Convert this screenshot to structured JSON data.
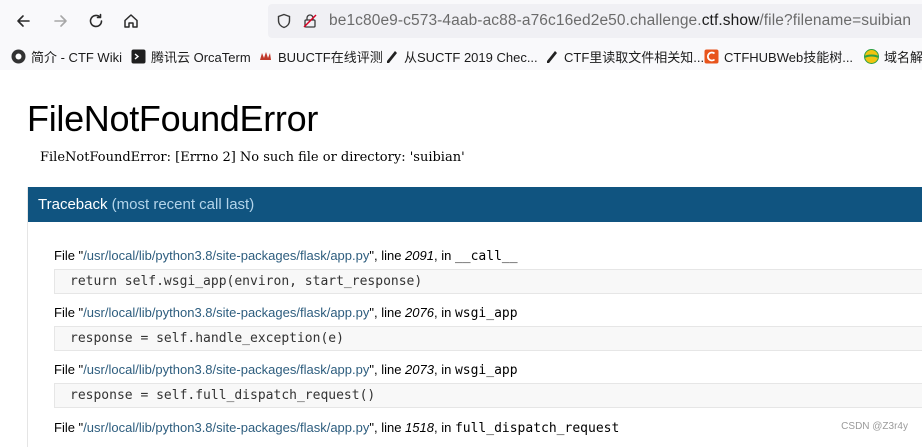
{
  "browser": {
    "url": {
      "prefix": "be1c80e9-c573-4aab-ac88-a76c16ed2e50.challenge.",
      "domain": "ctf.show",
      "suffix": "/file?filename=suibian"
    },
    "icons": {
      "back": "arrow-left-icon",
      "forward": "arrow-right-icon",
      "reload": "reload-icon",
      "home": "home-icon",
      "shield": "shield-icon",
      "insecure": "insecure-lock-icon"
    }
  },
  "bookmarks": [
    {
      "label": "简介 - CTF Wiki",
      "color": "#333333"
    },
    {
      "label": "腾讯云 OrcaTerm",
      "color": "#1f1f1f"
    },
    {
      "label": "BUUCTF在线评测",
      "color": "#c0392b"
    },
    {
      "label": "从SUCTF 2019 Chec...",
      "color": "#222222"
    },
    {
      "label": "CTF里读取文件相关知...",
      "color": "#222222"
    },
    {
      "label": "CTFHUBWeb技能树...",
      "color": "#e8541c"
    },
    {
      "label": "域名解",
      "color": "#2ea043"
    }
  ],
  "error": {
    "title": "FileNotFoundError",
    "message": "FileNotFoundError: [Errno 2] No such file or directory: 'suibian'"
  },
  "traceback": {
    "header": "Traceback",
    "header_note": "(most recent call last)",
    "frames": [
      {
        "file_prefix": "File \"",
        "path": "/usr/local/lib/python3.8/site-packages/flask/app.py",
        "line_label": "\", line ",
        "line": "2091",
        "in_label": ", in ",
        "func": "__call__",
        "code": "return self.wsgi_app(environ, start_response)"
      },
      {
        "file_prefix": "File \"",
        "path": "/usr/local/lib/python3.8/site-packages/flask/app.py",
        "line_label": "\", line ",
        "line": "2076",
        "in_label": ", in ",
        "func": "wsgi_app",
        "code": "response = self.handle_exception(e)"
      },
      {
        "file_prefix": "File \"",
        "path": "/usr/local/lib/python3.8/site-packages/flask/app.py",
        "line_label": "\", line ",
        "line": "2073",
        "in_label": ", in ",
        "func": "wsgi_app",
        "code": "response = self.full_dispatch_request()"
      },
      {
        "file_prefix": "File \"",
        "path": "/usr/local/lib/python3.8/site-packages/flask/app.py",
        "line_label": "\", line ",
        "line": "1518",
        "in_label": ", in ",
        "func": "full_dispatch_request",
        "code": ""
      }
    ]
  },
  "watermark": "CSDN @Z3r4y",
  "colors": {
    "traceback_header": "#105480",
    "path_text": "#2d5d7e"
  }
}
